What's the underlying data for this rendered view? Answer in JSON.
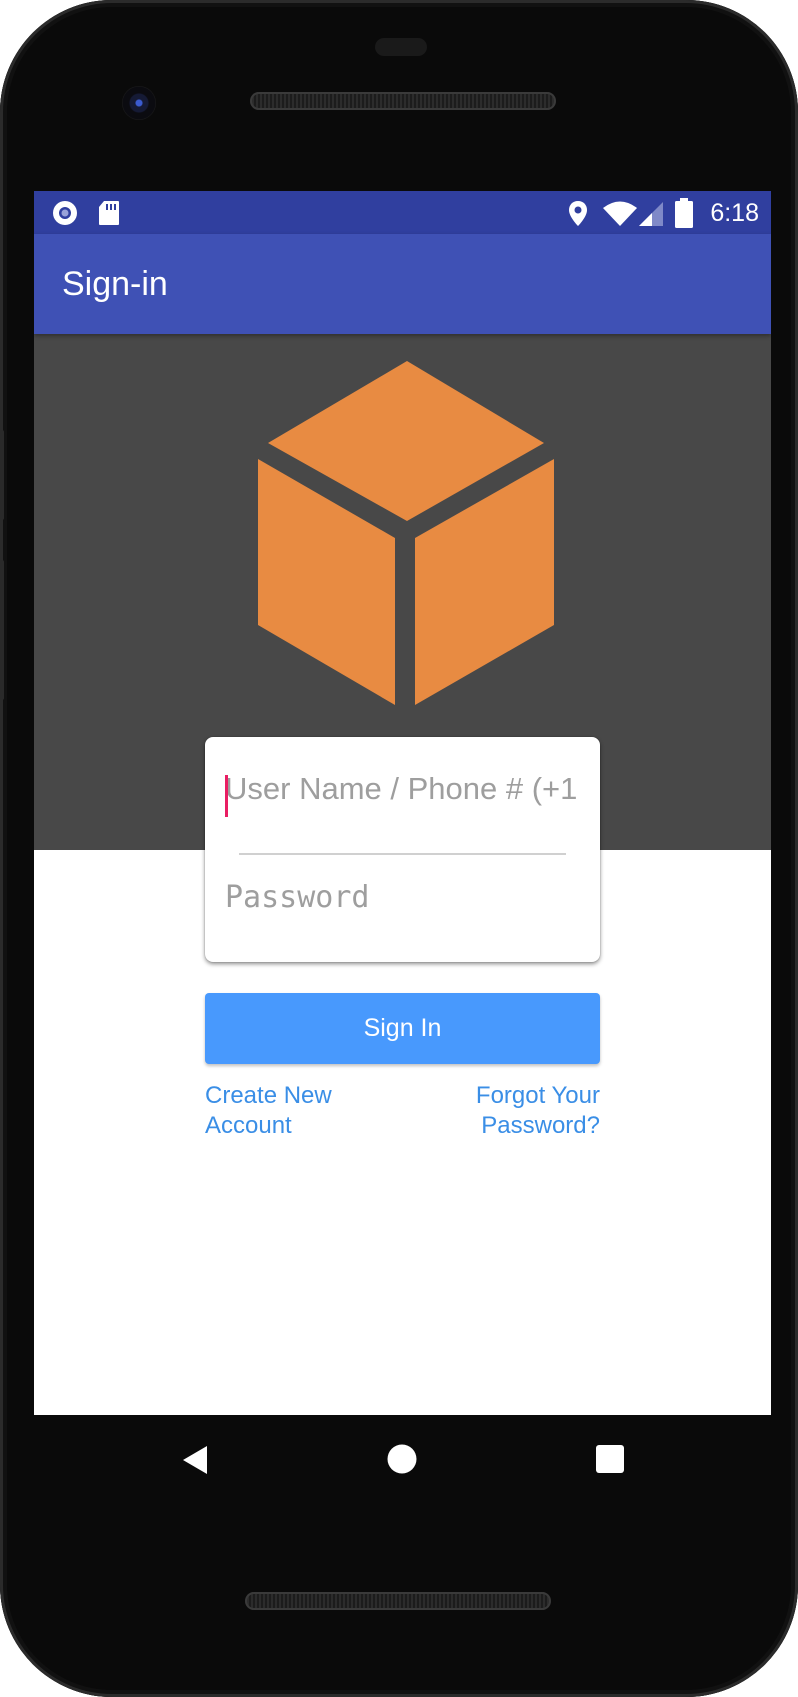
{
  "status_bar": {
    "time": "6:18",
    "icons": [
      "record-icon",
      "sd-card-icon",
      "location-icon",
      "wifi-icon",
      "signal-icon",
      "battery-icon"
    ]
  },
  "app_bar": {
    "title": "Sign-in"
  },
  "logo": {
    "icon": "cube-icon",
    "color": "#e88b42"
  },
  "login_form": {
    "username_placeholder": "User Name / Phone # (+1",
    "password_placeholder": "Password",
    "sign_in_label": "Sign In",
    "create_account_label": "Create New Account",
    "forgot_password_label": "Forgot Your Password?"
  },
  "nav_bar": {
    "buttons": [
      "back-icon",
      "home-icon",
      "recents-icon"
    ]
  },
  "colors": {
    "status_bar": "#303f9f",
    "app_bar": "#3f51b5",
    "dark_background": "#484848",
    "button": "#4899fd",
    "link": "#3a8ee6",
    "caret": "#e91e63"
  }
}
